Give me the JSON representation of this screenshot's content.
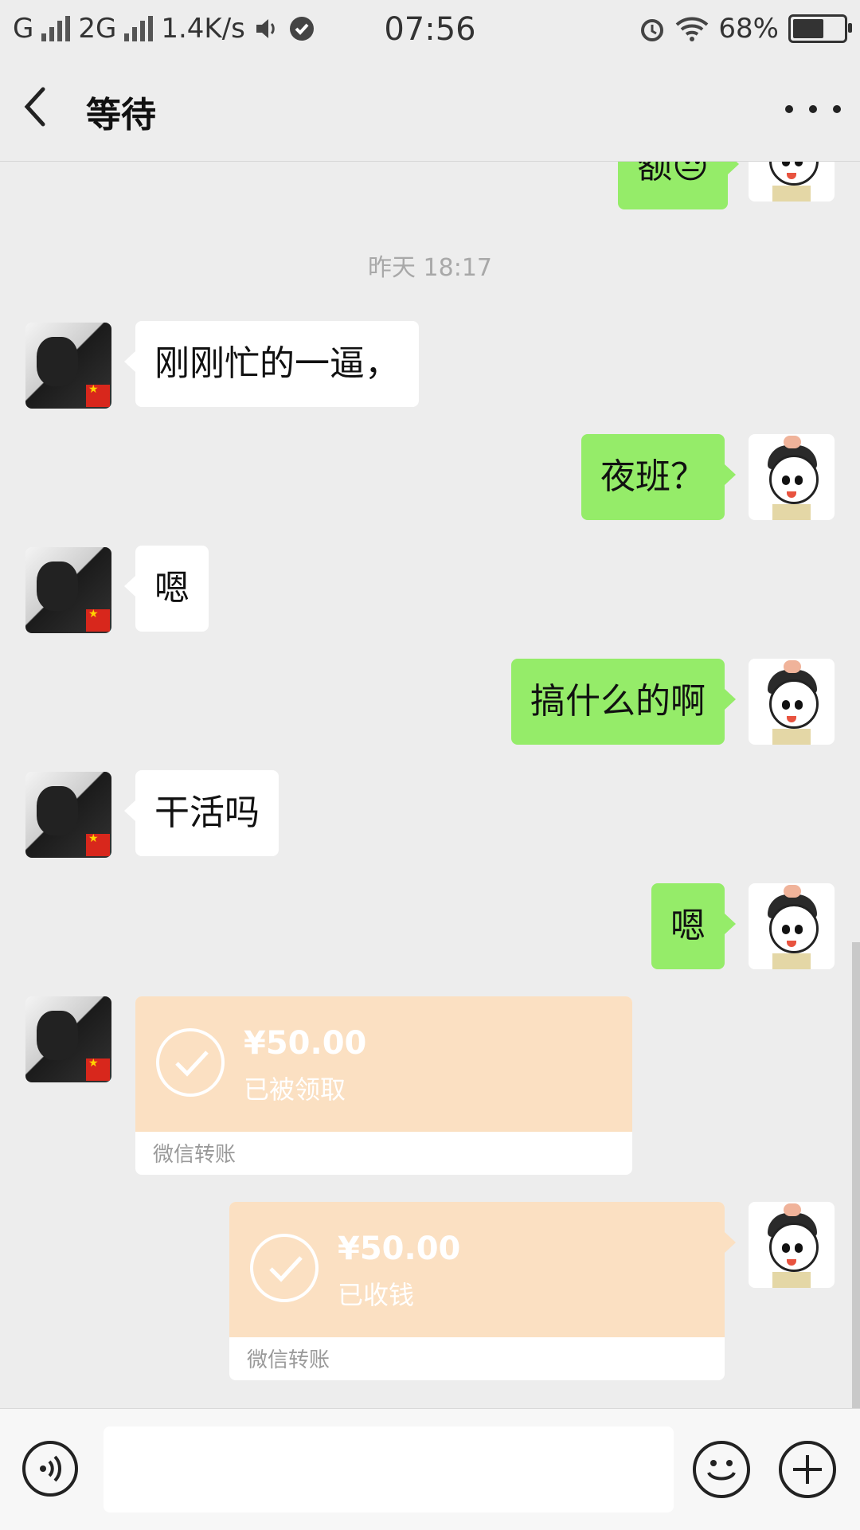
{
  "status_bar": {
    "carrier1": "G",
    "carrier2": "2G",
    "speed": "1.4K/s",
    "time": "07:56",
    "battery": "68%",
    "battery_level": 0.68
  },
  "header": {
    "title": "等待"
  },
  "chat": {
    "timestamp": "昨天 18:17",
    "partial_top_text": "额😒",
    "messages": [
      {
        "side": "left",
        "text": "刚刚忙的一逼，"
      },
      {
        "side": "right",
        "text": "夜班？"
      },
      {
        "side": "left",
        "text": "嗯"
      },
      {
        "side": "right",
        "text": "搞什么的啊"
      },
      {
        "side": "left",
        "text": "干活吗"
      },
      {
        "side": "right",
        "text": "嗯"
      }
    ],
    "transfers": [
      {
        "side": "left",
        "amount": "¥50.00",
        "status": "已被领取",
        "footer": "微信转账"
      },
      {
        "side": "right",
        "amount": "¥50.00",
        "status": "已收钱",
        "footer": "微信转账"
      }
    ]
  },
  "colors": {
    "self_bubble": "#95ec69",
    "other_bubble": "#ffffff",
    "transfer": "#fbe0c2",
    "background": "#ededed"
  }
}
